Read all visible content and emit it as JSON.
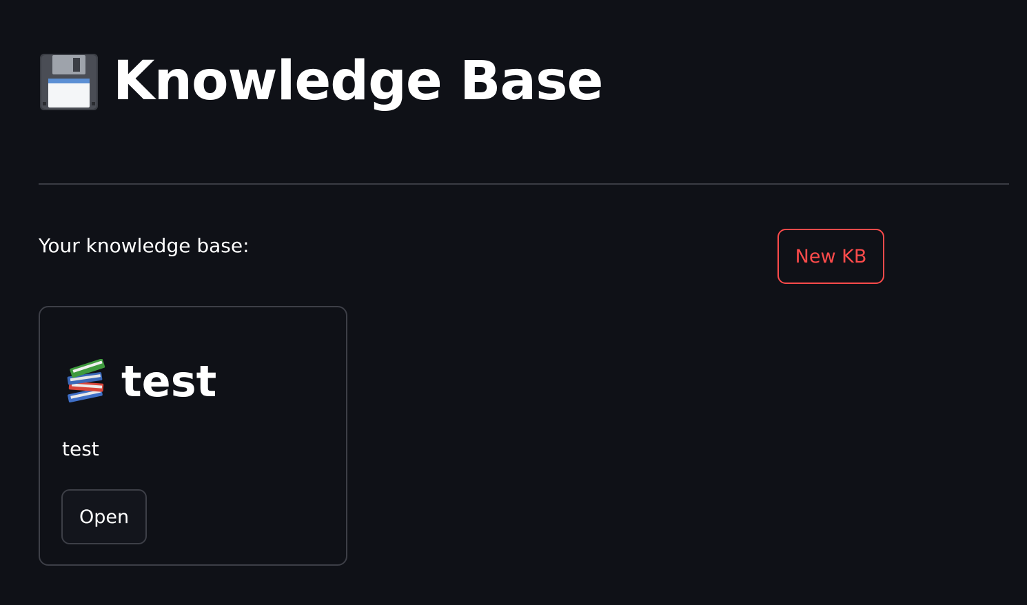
{
  "header": {
    "title": "Knowledge Base",
    "title_icon": "floppy-disk-icon"
  },
  "main": {
    "subtitle": "Your knowledge base:",
    "new_kb_label": "New KB",
    "accent_color": "#ff4b4b",
    "knowledge_bases": [
      {
        "icon": "books-icon",
        "name": "test",
        "description": "test",
        "open_label": "Open"
      }
    ]
  },
  "theme": {
    "background": "#0f1117",
    "text": "#ffffff",
    "border": "#3d3f47"
  }
}
